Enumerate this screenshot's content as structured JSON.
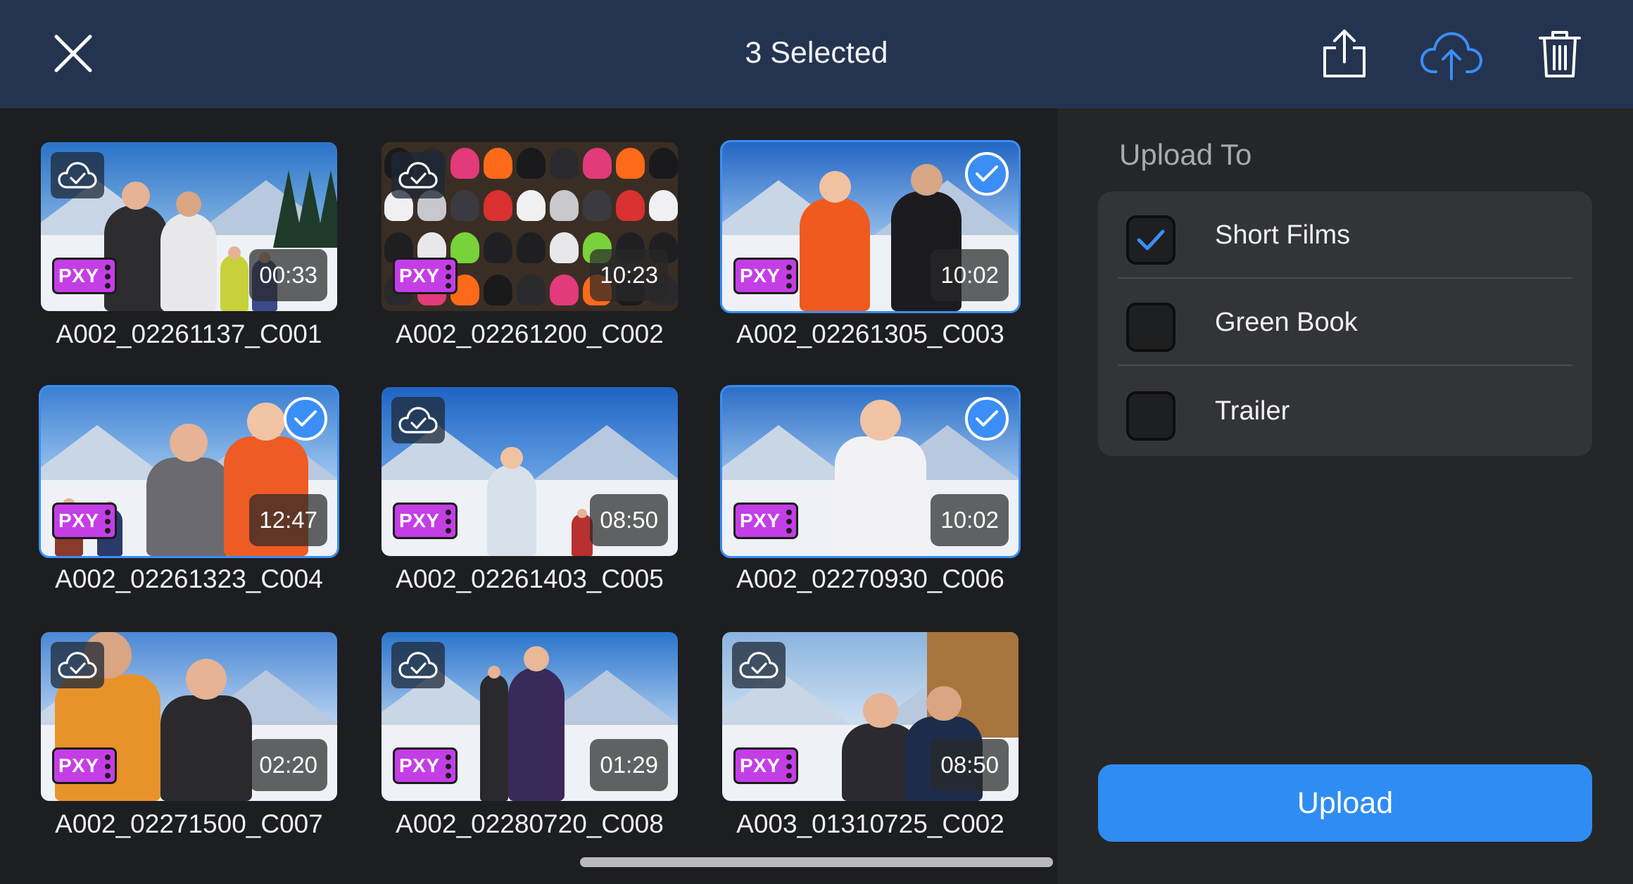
{
  "header": {
    "title": "3 Selected",
    "icons": [
      "close-icon",
      "share-icon",
      "cloud-upload-icon",
      "trash-icon"
    ]
  },
  "clips": [
    {
      "name": "A002_02261137_C001",
      "duration": "00:33",
      "selected": false,
      "badge": "PXY"
    },
    {
      "name": "A002_02261200_C002",
      "duration": "10:23",
      "selected": false,
      "badge": "PXY"
    },
    {
      "name": "A002_02261305_C003",
      "duration": "10:02",
      "selected": true,
      "badge": "PXY"
    },
    {
      "name": "A002_02261323_C004",
      "duration": "12:47",
      "selected": true,
      "badge": "PXY"
    },
    {
      "name": "A002_02261403_C005",
      "duration": "08:50",
      "selected": false,
      "badge": "PXY"
    },
    {
      "name": "A002_02270930_C006",
      "duration": "10:02",
      "selected": true,
      "badge": "PXY"
    },
    {
      "name": "A002_02271500_C007",
      "duration": "02:20",
      "selected": false,
      "badge": "PXY"
    },
    {
      "name": "A002_02280720_C008",
      "duration": "01:29",
      "selected": false,
      "badge": "PXY"
    },
    {
      "name": "A003_01310725_C002",
      "duration": "08:50",
      "selected": false,
      "badge": "PXY"
    }
  ],
  "sidebar": {
    "heading": "Upload To",
    "destinations": [
      {
        "label": "Short Films",
        "checked": true
      },
      {
        "label": "Green Book",
        "checked": false
      },
      {
        "label": "Trailer",
        "checked": false
      }
    ],
    "upload_label": "Upload"
  },
  "colors": {
    "accent": "#3a8ef6",
    "header_bg": "#243450",
    "proxy_badge": "#c43ee6",
    "upload_button": "#2f8cf3"
  }
}
